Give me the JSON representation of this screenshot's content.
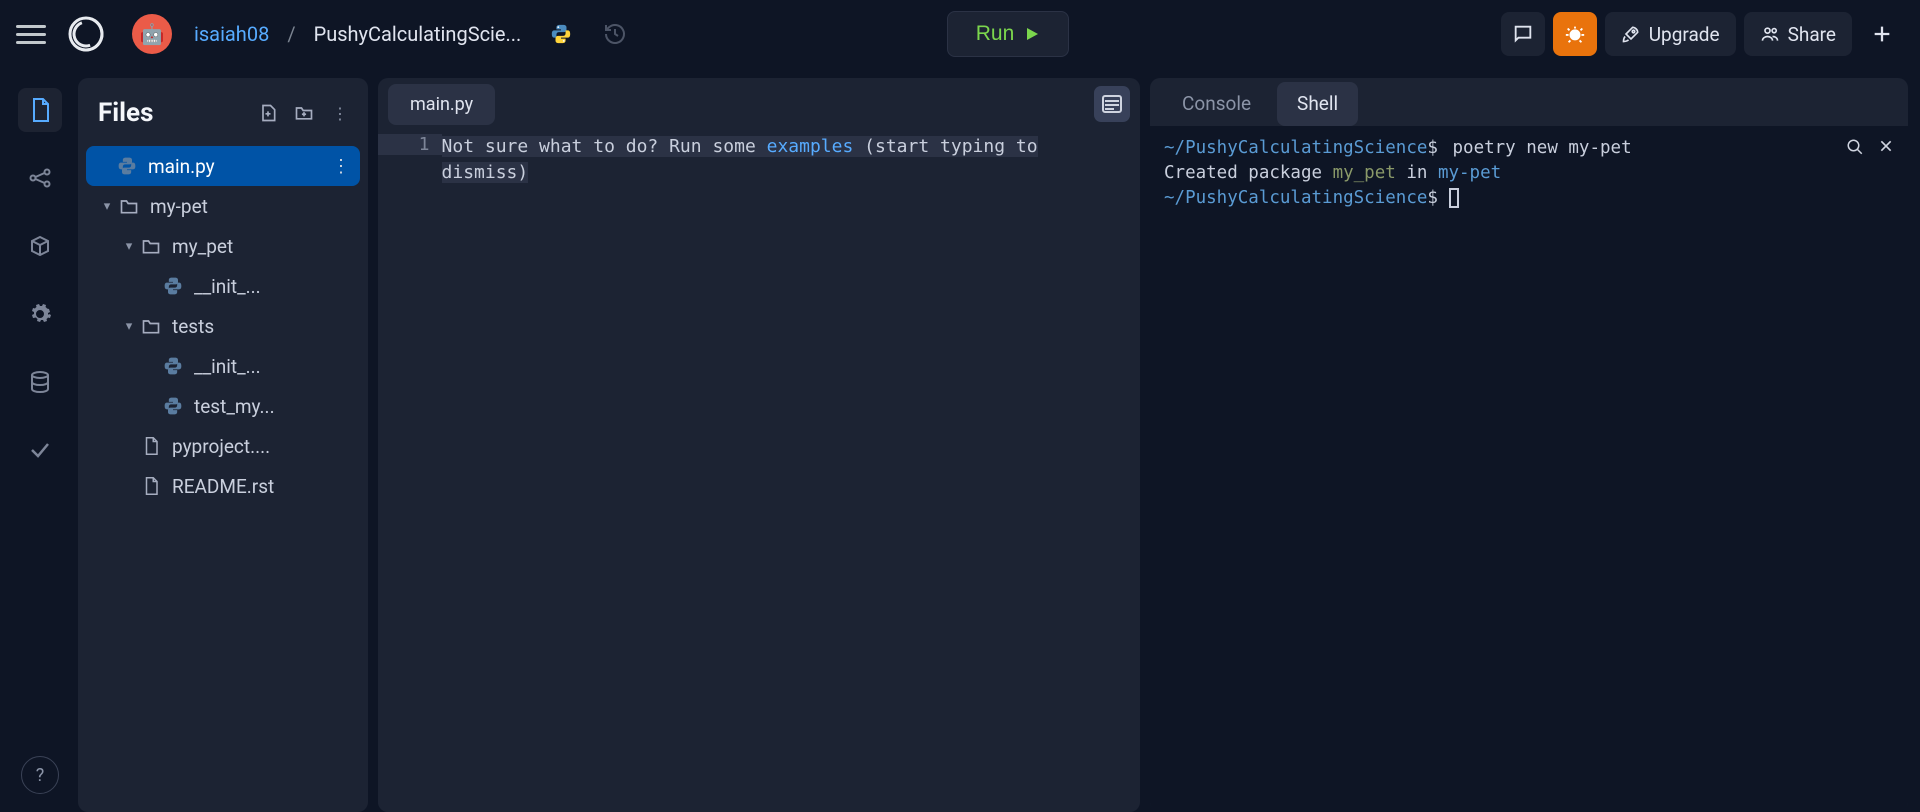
{
  "header": {
    "user": "isaiah08",
    "project": "PushyCalculatingScie...",
    "run_label": "Run",
    "upgrade_label": "Upgrade",
    "share_label": "Share"
  },
  "sidebar": {
    "title": "Files"
  },
  "files": [
    {
      "name": "main.py",
      "type": "py",
      "depth": 0,
      "selected": true,
      "chevron": ""
    },
    {
      "name": "my-pet",
      "type": "folder",
      "depth": 0,
      "chevron": "down"
    },
    {
      "name": "my_pet",
      "type": "folder",
      "depth": 1,
      "chevron": "down"
    },
    {
      "name": "__init_...",
      "type": "py",
      "depth": 2,
      "chevron": ""
    },
    {
      "name": "tests",
      "type": "folder",
      "depth": 1,
      "chevron": "down"
    },
    {
      "name": "__init_...",
      "type": "py",
      "depth": 2,
      "chevron": ""
    },
    {
      "name": "test_my...",
      "type": "py",
      "depth": 2,
      "chevron": ""
    },
    {
      "name": "pyproject....",
      "type": "file",
      "depth": 1,
      "chevron": ""
    },
    {
      "name": "README.rst",
      "type": "file",
      "depth": 1,
      "chevron": ""
    }
  ],
  "editor": {
    "tab": "main.py",
    "line_no": "1",
    "hint_pre": "Not sure what to do? Run some ",
    "hint_link": "examples",
    "hint_post": " (start typing to dismiss)"
  },
  "console": {
    "tab_console": "Console",
    "tab_shell": "Shell",
    "path": "~/PushyCalculatingScience",
    "prompt_char": "$",
    "cmd": "poetry new my-pet",
    "line2_pre": "Created package ",
    "line2_pkg": "my_pet",
    "line2_mid": " in ",
    "line2_dest": "my-pet"
  }
}
